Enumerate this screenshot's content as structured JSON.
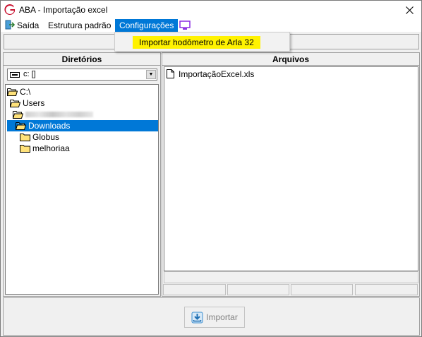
{
  "window": {
    "title": "ABA - Importação excel",
    "close_glyph": "✕",
    "app_icon": "app-g-icon"
  },
  "menubar": {
    "items": [
      {
        "label": "Saída",
        "icon": "exit-icon"
      },
      {
        "label": "Estrutura padrão"
      },
      {
        "label": "Configurações"
      }
    ],
    "extra_icon": "monitor-icon"
  },
  "dropdown": {
    "items": [
      {
        "label": "Importar hodômetro de Arla 32"
      }
    ],
    "highlight_color": "#fff200"
  },
  "directories": {
    "header": "Diretórios",
    "drive": "c: []",
    "tree": [
      {
        "label": "C:\\",
        "icon": "folder-open-icon"
      },
      {
        "label": "Users",
        "icon": "folder-open-icon"
      },
      {
        "label": "",
        "icon": "folder-open-icon",
        "redacted": true
      },
      {
        "label": "Downloads",
        "icon": "folder-open-icon",
        "selected": true
      },
      {
        "label": "Globus",
        "icon": "folder-closed-icon"
      },
      {
        "label": "melhoriaa",
        "icon": "folder-closed-icon"
      }
    ]
  },
  "files": {
    "header": "Arquivos",
    "items": [
      {
        "label": "ImportaçãoExcel.xls",
        "icon": "file-icon"
      }
    ]
  },
  "actions": {
    "import_label": "Importar",
    "import_icon": "download-icon"
  },
  "colors": {
    "selection": "#0078d7",
    "menu_active": "#0078d7",
    "app_icon": "#c8102e",
    "monitor_icon": "#8a2be2"
  }
}
